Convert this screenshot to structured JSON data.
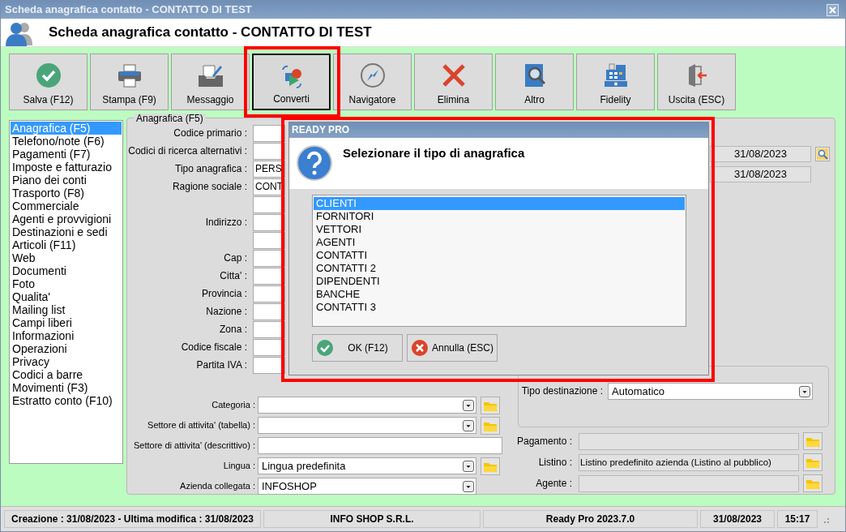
{
  "window": {
    "title": "Scheda anagrafica contatto - CONTATTO DI TEST"
  },
  "header": {
    "title": "Scheda anagrafica contatto - CONTATTO DI TEST"
  },
  "toolbar": [
    {
      "label": "Salva (F12)",
      "kind": "save",
      "pressed": false,
      "highlighted": false
    },
    {
      "label": "Stampa (F9)",
      "kind": "print",
      "pressed": false,
      "highlighted": false
    },
    {
      "label": "Messaggio",
      "kind": "message",
      "pressed": false,
      "highlighted": false
    },
    {
      "label": "Converti",
      "kind": "convert",
      "pressed": true,
      "highlighted": true
    },
    {
      "label": "Navigatore",
      "kind": "navigator",
      "pressed": false,
      "highlighted": false
    },
    {
      "label": "Elimina",
      "kind": "delete",
      "pressed": false,
      "highlighted": false
    },
    {
      "label": "Altro",
      "kind": "other",
      "pressed": false,
      "highlighted": false
    },
    {
      "label": "Fidelity",
      "kind": "register",
      "pressed": false,
      "highlighted": false
    },
    {
      "label": "Uscita (ESC)",
      "kind": "exit",
      "pressed": false,
      "highlighted": false
    }
  ],
  "sidebar": {
    "items": [
      {
        "label": "Anagrafica (F5)",
        "selected": true
      },
      {
        "label": "Telefono/note (F6)",
        "selected": false
      },
      {
        "label": "Pagamenti (F7)",
        "selected": false
      },
      {
        "label": "Imposte e fatturazio",
        "selected": false
      },
      {
        "label": "Piano dei conti",
        "selected": false
      },
      {
        "label": "Trasporto (F8)",
        "selected": false
      },
      {
        "label": "Commerciale",
        "selected": false
      },
      {
        "label": "Agenti e provvigioni",
        "selected": false
      },
      {
        "label": "Destinazioni e sedi",
        "selected": false
      },
      {
        "label": "Articoli (F11)",
        "selected": false
      },
      {
        "label": "Web",
        "selected": false
      },
      {
        "label": "Documenti",
        "selected": false
      },
      {
        "label": "Foto",
        "selected": false
      },
      {
        "label": "Qualita'",
        "selected": false
      },
      {
        "label": "Mailing list",
        "selected": false
      },
      {
        "label": "Campi liberi",
        "selected": false
      },
      {
        "label": "Informazioni",
        "selected": false
      },
      {
        "label": "Operazioni",
        "selected": false
      },
      {
        "label": "Privacy",
        "selected": false
      },
      {
        "label": "Codici a barre",
        "selected": false
      },
      {
        "label": "Movimenti (F3)",
        "selected": false
      },
      {
        "label": "Estratto conto (F10)",
        "selected": false
      }
    ]
  },
  "form": {
    "legend": "Anagrafica (F5)",
    "fields": [
      {
        "label": "Codice primario :",
        "kind": "text"
      },
      {
        "label": "Codici di ricerca alternativi :",
        "kind": "text"
      },
      {
        "label": "Tipo anagrafica :",
        "value": "PERS",
        "kind": "text"
      },
      {
        "label": "Ragione sociale :",
        "value": "CONT",
        "kind": "text"
      },
      {
        "kind": "text"
      },
      {
        "label": "Indirizzo :",
        "kind": "text"
      },
      {
        "kind": "text"
      },
      {
        "label": "Cap :",
        "kind": "text"
      },
      {
        "label": "Citta' :",
        "kind": "text"
      },
      {
        "label": "Provincia :",
        "kind": "text"
      },
      {
        "label": "Nazione :",
        "kind": "text"
      },
      {
        "label": "Zona :",
        "kind": "text"
      },
      {
        "label": "Codice fiscale :",
        "kind": "text"
      },
      {
        "label": "Partita IVA :",
        "kind": "text"
      }
    ],
    "classification": [
      {
        "label": "Categoria :",
        "kind": "select",
        "browse": true
      },
      {
        "label": "Settore di attivita' (tabella) :",
        "kind": "select",
        "browse": true
      },
      {
        "label": "Settore di attivita' (descrittivo) :",
        "kind": "text",
        "browse": false
      },
      {
        "label": "Lingua :",
        "kind": "select",
        "value": "Lingua predefinita",
        "browse": true
      },
      {
        "label": "Azienda collegata :",
        "kind": "select",
        "value": "INFOSHOP",
        "browse": false
      }
    ],
    "dates": [
      {
        "value": "31/08/2023",
        "search": true
      },
      {
        "value": "31/08/2023",
        "search": false
      }
    ],
    "destination": {
      "label": "Tipo destinazione :",
      "value": "Automatico"
    },
    "commercial": [
      {
        "label": "Pagamento :"
      },
      {
        "label": "Listino :",
        "value": "Listino predefinito azienda (Listino al pubblico)"
      },
      {
        "label": "Agente :"
      }
    ]
  },
  "dialog": {
    "title": "READY PRO",
    "message": "Selezionare il tipo di anagrafica",
    "highlighted": true,
    "options": [
      {
        "label": "CLIENTI",
        "selected": true
      },
      {
        "label": "FORNITORI",
        "selected": false
      },
      {
        "label": "VETTORI",
        "selected": false
      },
      {
        "label": "AGENTI",
        "selected": false
      },
      {
        "label": "CONTATTI",
        "selected": false
      },
      {
        "label": "CONTATTI 2",
        "selected": false
      },
      {
        "label": "DIPENDENTI",
        "selected": false
      },
      {
        "label": "BANCHE",
        "selected": false
      },
      {
        "label": "CONTATTI 3",
        "selected": false
      }
    ],
    "buttons": [
      {
        "label": "OK (F12)",
        "kind": "ok"
      },
      {
        "label": "Annulla (ESC)",
        "kind": "cancel"
      }
    ]
  },
  "status_bar": [
    "Creazione : 31/08/2023 - Ultima modifica : 31/08/2023",
    "INFO SHOP S.R.L.",
    "Ready Pro 2023.7.0",
    "31/08/2023",
    "15:17"
  ]
}
